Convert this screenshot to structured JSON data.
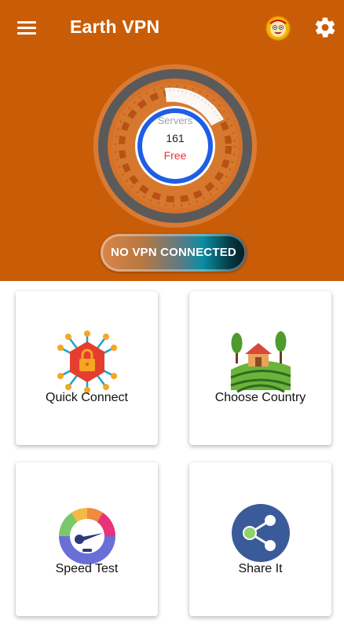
{
  "app": {
    "title": "Earth VPN"
  },
  "header": {
    "menu_icon": "hamburger-menu-icon",
    "avatar_icon": "app-mascot-avatar",
    "settings_icon": "gear-icon"
  },
  "gauge": {
    "servers_label": "Servers",
    "server_count": "161",
    "plan_label": "Free"
  },
  "status": {
    "text": "NO VPN CONNECTED"
  },
  "cards": [
    {
      "label": "Quick Connect",
      "icon": "lock-network-icon"
    },
    {
      "label": "Choose Country",
      "icon": "countryside-farm-icon"
    },
    {
      "label": "Speed Test",
      "icon": "speedometer-icon"
    },
    {
      "label": "Share It",
      "icon": "share-icon"
    }
  ],
  "colors": {
    "header_bg": "#c95d07",
    "accent_blue": "#1e5ee6",
    "free_red": "#e53935"
  }
}
